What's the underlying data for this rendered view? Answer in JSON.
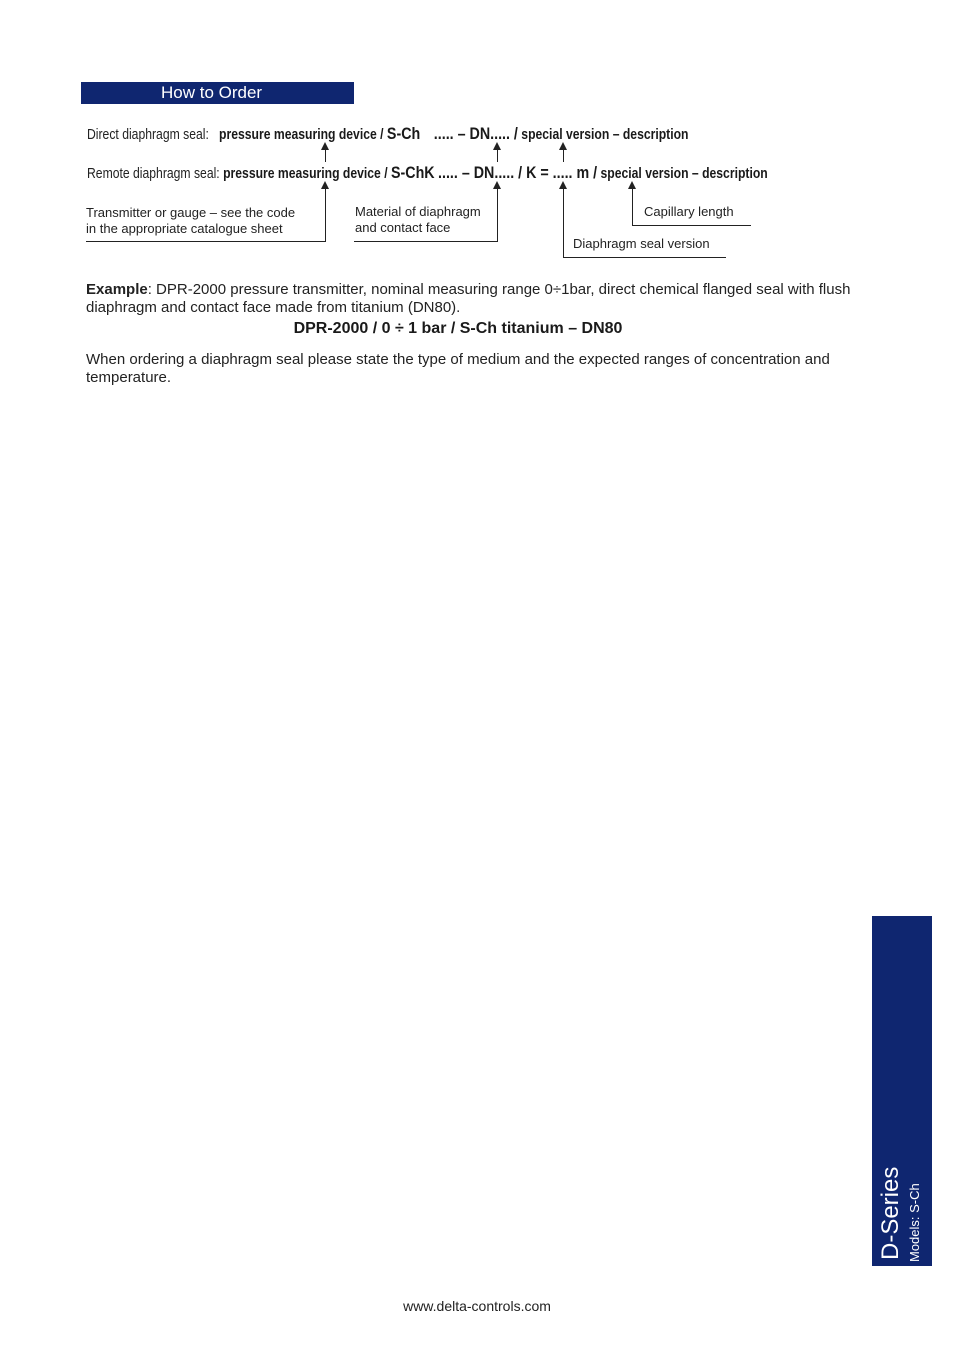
{
  "header": {
    "title": "How to Order"
  },
  "direct_row": {
    "label": "Direct diaphragm seal:",
    "device": "pressure measuring device /",
    "model": "S-Ch",
    "code": "..... – DN..... /",
    "suffix": "special version – description"
  },
  "remote_row": {
    "label": "Remote diaphragm seal:",
    "device": "pressure measuring device /",
    "model": "S-ChK",
    "code": "..... – DN..... / K = ..... m /",
    "suffix": "special version – description"
  },
  "callouts": {
    "transmitter_line1": "Transmitter or gauge – see the code",
    "transmitter_line2": "in the appropriate catalogue sheet",
    "material_line1": "Material of diaphragm",
    "material_line2": "and contact face",
    "capillary": "Capillary length",
    "seal_version": "Diaphragm seal version"
  },
  "example": {
    "label": "Example",
    "text": ": DPR-2000 pressure transmitter, nominal measuring range 0÷1bar, direct chemical flanged seal with flush diaphragm and contact face made from titanium (DN80).",
    "code": "DPR-2000 / 0 ÷ 1 bar / S-Ch titanium – DN80"
  },
  "note": "When ordering a diaphragm seal please state the type of medium and the expected ranges of concentration and temperature.",
  "side_tab": {
    "series": "D-Series",
    "models": "Models: S-Ch"
  },
  "footer": {
    "url": "www.delta-controls.com"
  },
  "colors": {
    "brand_blue": "#0f2670"
  }
}
